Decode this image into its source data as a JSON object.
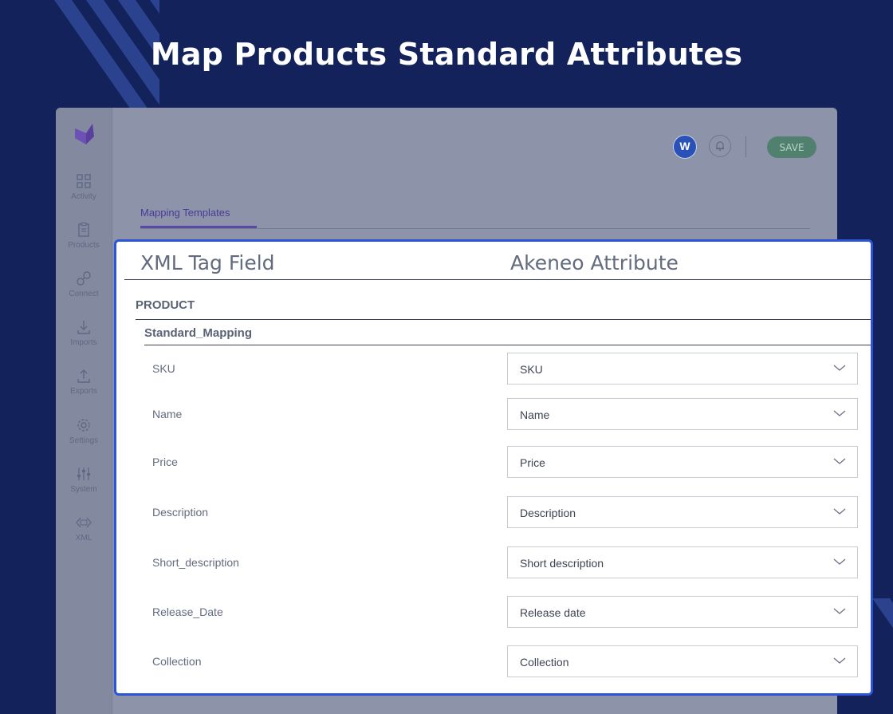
{
  "hero": {
    "title": "Map Products Standard Attributes"
  },
  "sidebar": {
    "items": [
      {
        "label": "Activity",
        "icon": "grid-icon"
      },
      {
        "label": "Products",
        "icon": "clipboard-icon"
      },
      {
        "label": "Connect",
        "icon": "link-icon"
      },
      {
        "label": "Imports",
        "icon": "download-icon"
      },
      {
        "label": "Exports",
        "icon": "upload-icon"
      },
      {
        "label": "Settings",
        "icon": "gear-icon"
      },
      {
        "label": "System",
        "icon": "sliders-icon"
      },
      {
        "label": "XML",
        "icon": "xml-icon"
      }
    ]
  },
  "topbar": {
    "badge_letter": "W",
    "save_label": "SAVE"
  },
  "tabs": {
    "active": "Mapping Templates"
  },
  "panel": {
    "col_xml": "XML Tag Field",
    "col_akeneo": "Akeneo Attribute",
    "section": "PRODUCT",
    "group": "Standard_Mapping",
    "rows": [
      {
        "field": "SKU",
        "value": "SKU"
      },
      {
        "field": "Name",
        "value": "Name"
      },
      {
        "field": "Price",
        "value": "Price"
      },
      {
        "field": "Description",
        "value": "Description"
      },
      {
        "field": "Short_description",
        "value": "Short description"
      },
      {
        "field": "Release_Date",
        "value": "Release date"
      },
      {
        "field": "Collection",
        "value": "Collection"
      }
    ]
  },
  "colors": {
    "background": "#13225a",
    "accent_border": "#2c54d8",
    "save_button": "#52806f",
    "tab_active": "#5b49a8"
  }
}
